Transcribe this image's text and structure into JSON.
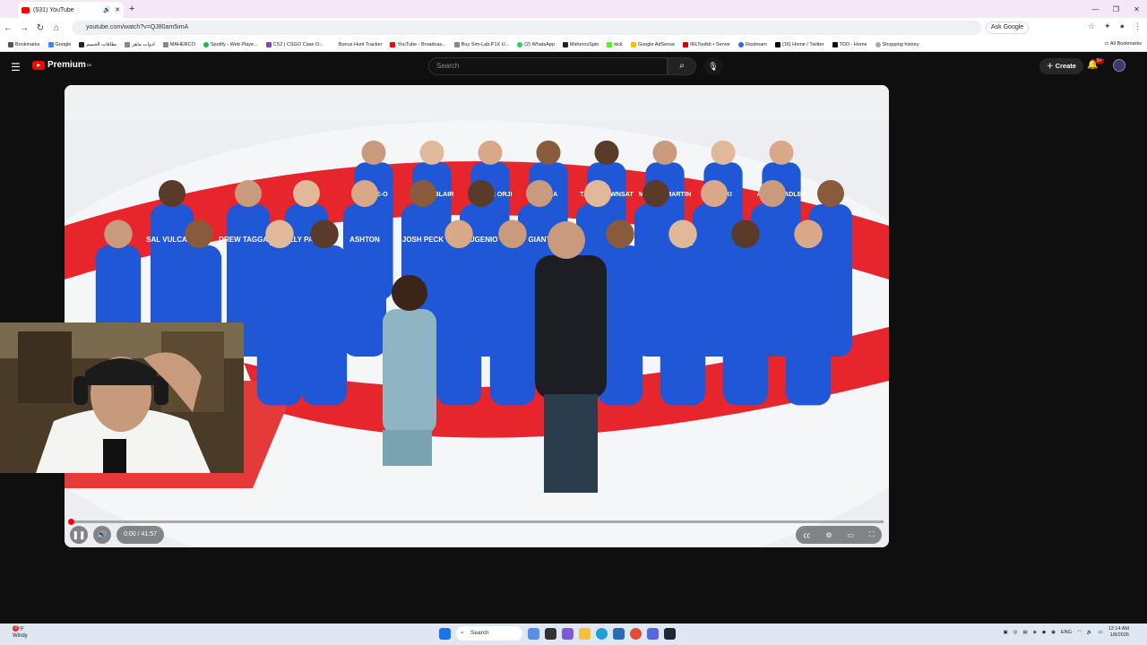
{
  "browser": {
    "tab_title": "(531) YouTube",
    "url": "youtube.com/watch?v=QJ80am5imA",
    "ask_google": "Ask Google",
    "bookmarks": [
      "Bookmarks",
      "Google",
      "بطاقات الحسم",
      "ادوات ماهر",
      "MAHERCO",
      "Spotify - Web Playe...",
      "CS2 | CSGO Case O...",
      "Bonus Hunt Tracker",
      "YouTube - Broadcas...",
      "Buy Sim-Lab P1X U...",
      "(2) WhatsApp",
      "MahercoSpin",
      "kick",
      "Google AdSense",
      "IRLToolkit • Server",
      "Restream",
      "(16) Home / Twitter",
      "TOD - Home",
      "Shopping history"
    ],
    "all_bookmarks": "All Bookmarks"
  },
  "youtube": {
    "logo": "Premium",
    "region": "DE",
    "search_placeholder": "Search",
    "create_label": "Create",
    "notif_badge": "9+"
  },
  "player": {
    "time": "0:00 / 41:57",
    "progress_fraction": 0.001,
    "shirts": [
      "STEVE-O",
      "SELMA BLAIR",
      "YVONNE ORJI",
      "SARA",
      "TARRYTOWNSAT",
      "MARSAI MARTIN",
      "NIKKI",
      "ALLY BRADLEY",
      "SAL VULCANO",
      "DREW TAGGART",
      "ALLY PARRA",
      "ASHTON",
      "JOSH PECK",
      "EUGENIO",
      "GIANT"
    ]
  },
  "taskbar": {
    "temp": "51°F",
    "weather": "Windy",
    "notif": "3",
    "search": "Search",
    "lang": "ENG",
    "time": "12:14 AM",
    "date": "1/8/2026"
  }
}
